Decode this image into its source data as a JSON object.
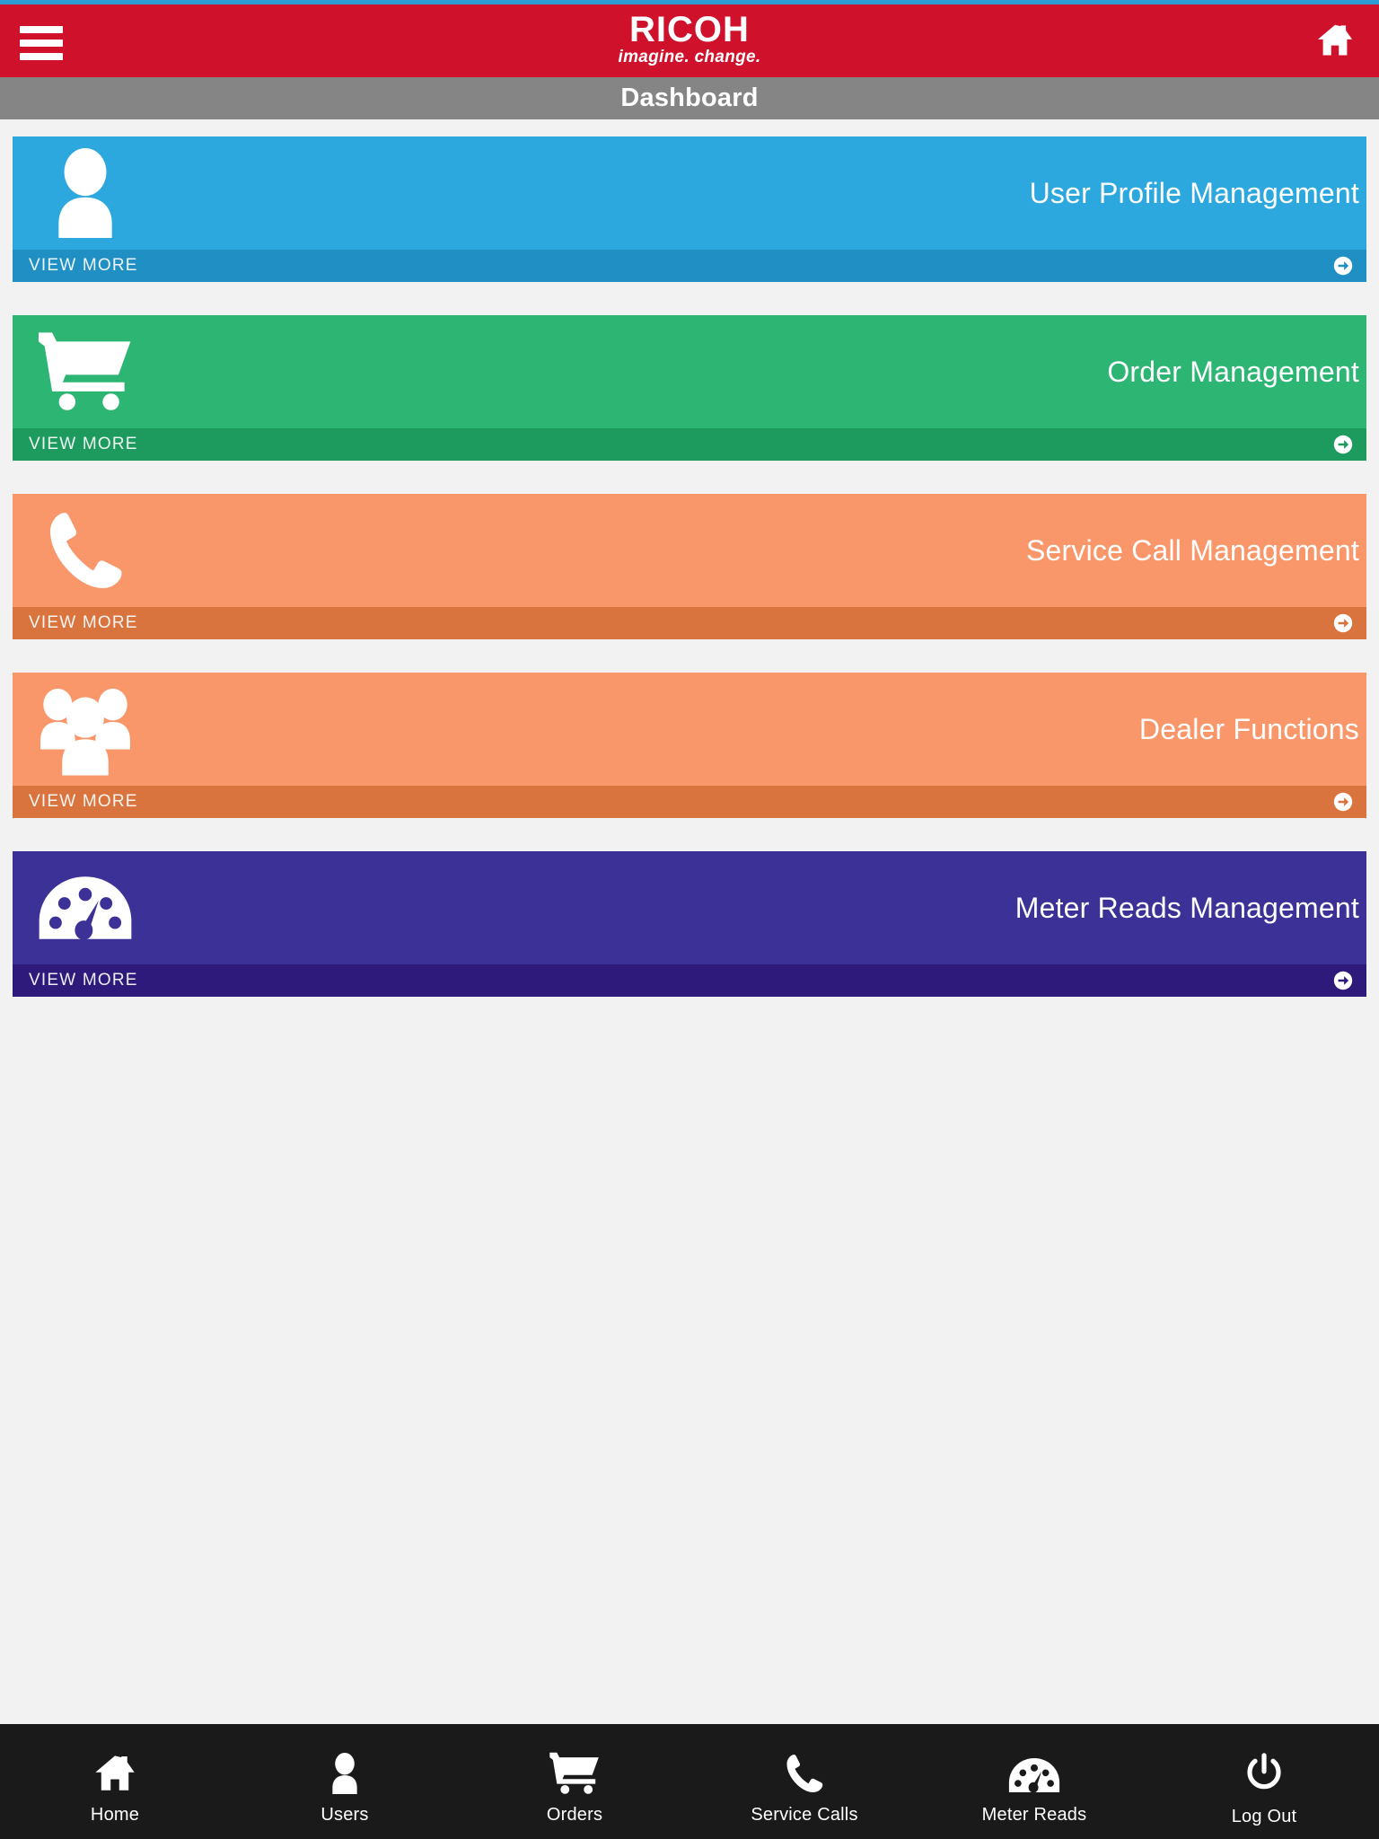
{
  "header": {
    "menu_icon": "hamburger-menu-icon",
    "logo_word": "RICOH",
    "logo_tagline": "imagine. change.",
    "home_icon": "home-icon",
    "bar_color": "#d0112b",
    "accent_strip_color": "#2f9bd4"
  },
  "title_bar": {
    "title": "Dashboard",
    "background": "#858585"
  },
  "cards": [
    {
      "title": "User Profile Management",
      "icon": "user-icon",
      "view_more_label": "VIEW MORE",
      "arrow_icon": "arrow-right-circle-icon",
      "body_color": "#2ca8df",
      "footer_color": "#1f8fc4"
    },
    {
      "title": "Order Management",
      "icon": "shopping-cart-icon",
      "view_more_label": "VIEW MORE",
      "arrow_icon": "arrow-right-circle-icon",
      "body_color": "#2cb573",
      "footer_color": "#1d9a5e"
    },
    {
      "title": "Service Call Management",
      "icon": "phone-icon",
      "view_more_label": "VIEW MORE",
      "arrow_icon": "arrow-right-circle-icon",
      "body_color": "#f9976b",
      "footer_color": "#d9743e"
    },
    {
      "title": "Dealer Functions",
      "icon": "group-users-icon",
      "view_more_label": "VIEW MORE",
      "arrow_icon": "arrow-right-circle-icon",
      "body_color": "#f9976b",
      "footer_color": "#d9743e"
    },
    {
      "title": "Meter Reads Management",
      "icon": "gauge-icon",
      "view_more_label": "VIEW MORE",
      "arrow_icon": "arrow-right-circle-icon",
      "body_color": "#3b3196",
      "footer_color": "#2d1a7a"
    }
  ],
  "bottom_nav": {
    "background": "#1a1a1a",
    "items": [
      {
        "label": "Home",
        "icon": "home-icon"
      },
      {
        "label": "Users",
        "icon": "user-icon"
      },
      {
        "label": "Orders",
        "icon": "shopping-cart-icon"
      },
      {
        "label": "Service Calls",
        "icon": "phone-icon"
      },
      {
        "label": "Meter Reads",
        "icon": "gauge-icon"
      },
      {
        "label": "Log Out",
        "icon": "power-icon"
      }
    ]
  }
}
